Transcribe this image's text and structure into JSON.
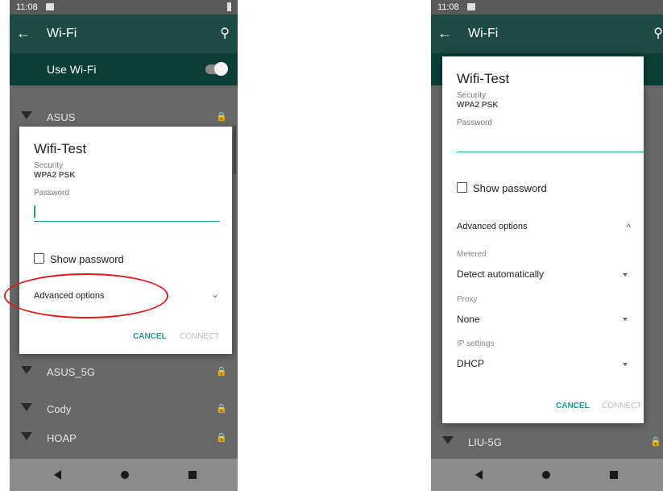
{
  "status_time": "11:08",
  "appbar": {
    "title": "Wi-Fi",
    "back_icon": "arrow-left-icon",
    "search_icon": "search-icon"
  },
  "use_wifi": {
    "label": "Use Wi-Fi",
    "on": true
  },
  "left": {
    "networks_above": [
      "ASUS"
    ],
    "networks_below": [
      "ASUS_5G",
      "Cody",
      "HOAP"
    ],
    "dialog": {
      "title": "Wifi-Test",
      "security_label": "Security",
      "security_value": "WPA2 PSK",
      "password_label": "Password",
      "show_password": "Show password",
      "advanced": "Advanced options",
      "advanced_chevron": "⌄",
      "cancel": "CANCEL",
      "connect": "CONNECT"
    }
  },
  "right": {
    "networks_below": [
      "LIU-5G"
    ],
    "dialog": {
      "title": "Wifi-Test",
      "security_label": "Security",
      "security_value": "WPA2 PSK",
      "password_label": "Password",
      "show_password": "Show password",
      "advanced": "Advanced options",
      "advanced_chevron": "^",
      "metered_label": "Metered",
      "metered_value": "Detect automatically",
      "proxy_label": "Proxy",
      "proxy_value": "None",
      "ip_label": "IP settings",
      "ip_value": "DHCP",
      "cancel": "CANCEL",
      "connect": "CONNECT"
    }
  },
  "colors": {
    "accent": "#1f9e8c",
    "appbar": "#1d4a44",
    "highlight": "#e0191c"
  }
}
